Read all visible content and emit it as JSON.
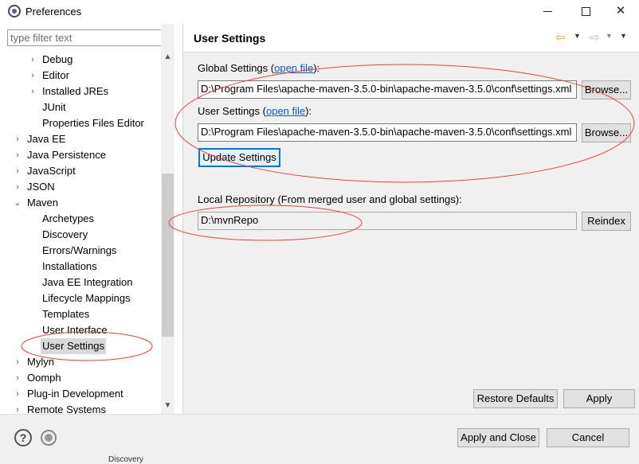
{
  "window": {
    "title": "Preferences",
    "minimize_icon": "minimize-icon",
    "maximize_icon": "maximize-icon",
    "close_icon": "close-icon"
  },
  "sidebar": {
    "filter_placeholder": "type filter text",
    "items": [
      {
        "label": "Debug",
        "arrow": "›",
        "level": 1
      },
      {
        "label": "Editor",
        "arrow": "›",
        "level": 1
      },
      {
        "label": "Installed JREs",
        "arrow": "›",
        "level": 1
      },
      {
        "label": "JUnit",
        "arrow": "",
        "level": 1
      },
      {
        "label": "Properties Files Editor",
        "arrow": "",
        "level": 1
      },
      {
        "label": "Java EE",
        "arrow": "›",
        "level": 0
      },
      {
        "label": "Java Persistence",
        "arrow": "›",
        "level": 0
      },
      {
        "label": "JavaScript",
        "arrow": "›",
        "level": 0
      },
      {
        "label": "JSON",
        "arrow": "›",
        "level": 0
      },
      {
        "label": "Maven",
        "arrow": "⌄",
        "level": 0
      },
      {
        "label": "Archetypes",
        "arrow": "",
        "level": 1
      },
      {
        "label": "Discovery",
        "arrow": "",
        "level": 1
      },
      {
        "label": "Errors/Warnings",
        "arrow": "",
        "level": 1
      },
      {
        "label": "Installations",
        "arrow": "",
        "level": 1
      },
      {
        "label": "Java EE Integration",
        "arrow": "",
        "level": 1
      },
      {
        "label": "Lifecycle Mappings",
        "arrow": "",
        "level": 1
      },
      {
        "label": "Templates",
        "arrow": "",
        "level": 1
      },
      {
        "label": "User Interface",
        "arrow": "",
        "level": 1
      },
      {
        "label": "User Settings",
        "arrow": "",
        "level": 1,
        "selected": true
      },
      {
        "label": "Mylyn",
        "arrow": "›",
        "level": 0
      },
      {
        "label": "Oomph",
        "arrow": "›",
        "level": 0
      },
      {
        "label": "Plug-in Development",
        "arrow": "›",
        "level": 0
      },
      {
        "label": "Remote Systems",
        "arrow": "›",
        "level": 0
      }
    ]
  },
  "page": {
    "title": "User Settings",
    "global": {
      "label_prefix": "Global Settings (",
      "link": "open file",
      "label_suffix": "):",
      "value": "D:\\Program Files\\apache-maven-3.5.0-bin\\apache-maven-3.5.0\\conf\\settings.xml",
      "browse_label": "Browse..."
    },
    "user": {
      "label_prefix": "User Settings (",
      "link": "open file",
      "label_suffix": "):",
      "value": "D:\\Program Files\\apache-maven-3.5.0-bin\\apache-maven-3.5.0\\conf\\settings.xml",
      "browse_label": "Browse..."
    },
    "update_label": "Update Settings",
    "local_repo": {
      "label": "Local Repository (From merged user and global settings):",
      "value": "D:\\mvnRepo",
      "reindex_label": "Reindex"
    },
    "restore_defaults_label": "Restore Defaults",
    "apply_label": "Apply"
  },
  "footer": {
    "help_symbol": "?",
    "apply_close_label": "Apply and Close",
    "cancel_label": "Cancel",
    "taskbar_peek": "Discovery"
  },
  "annotation_color": "#e8403a"
}
